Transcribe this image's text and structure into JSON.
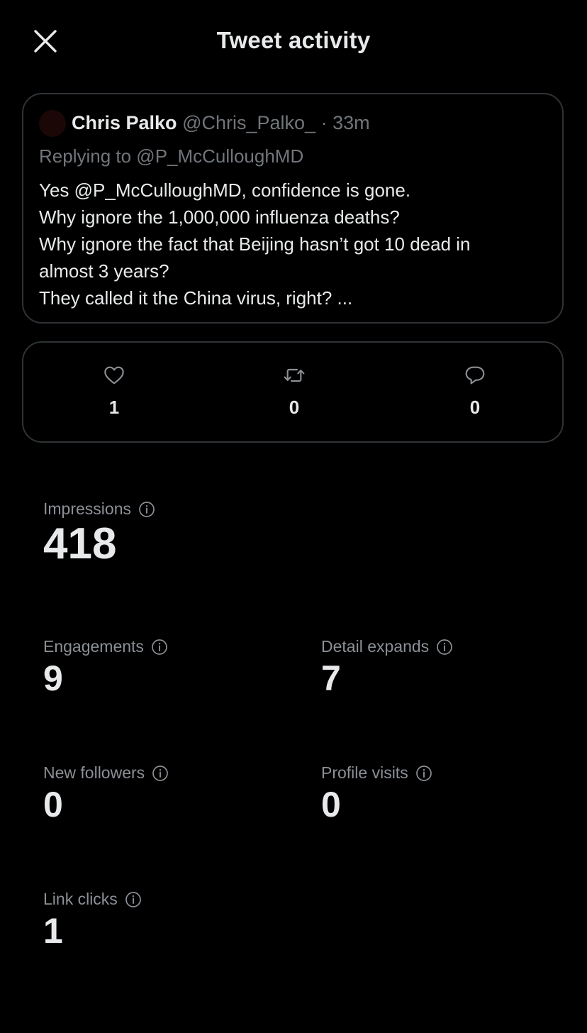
{
  "header": {
    "title": "Tweet activity",
    "close_icon": "close-icon"
  },
  "tweet": {
    "author_name": "Chris Palko",
    "author_handle": "@Chris_Palko_",
    "separator": "·",
    "time": "33m",
    "replying_to": "Replying to @P_McCulloughMD",
    "lines": [
      "Yes @P_McCulloughMD, confidence is gone.",
      "Why ignore the 1,000,000 influenza deaths?",
      "Why ignore the fact that Beijing hasn’t got 10 dead in",
      "almost 3 years?",
      "They called it the China virus, right? ..."
    ]
  },
  "interactions": {
    "likes": {
      "icon": "heart-icon",
      "value": "1"
    },
    "retweets": {
      "icon": "retweet-icon",
      "value": "0"
    },
    "replies": {
      "icon": "reply-icon",
      "value": "0"
    }
  },
  "metrics": {
    "impressions": {
      "label": "Impressions",
      "value": "418"
    },
    "engagements": {
      "label": "Engagements",
      "value": "9"
    },
    "detail_expands": {
      "label": "Detail expands",
      "value": "7"
    },
    "new_followers": {
      "label": "New followers",
      "value": "0"
    },
    "profile_visits": {
      "label": "Profile visits",
      "value": "0"
    },
    "link_clicks": {
      "label": "Link clicks",
      "value": "1"
    }
  },
  "colors": {
    "background": "#000000",
    "text_primary": "#e7e9ea",
    "text_secondary": "#71767b",
    "border": "#2f3336"
  }
}
